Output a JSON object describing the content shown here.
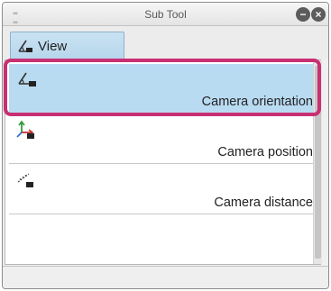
{
  "window": {
    "title": "Sub Tool",
    "grip_icon": "grip-icon",
    "minimize_icon": "minimize-icon",
    "close_icon": "close-icon",
    "minimize_glyph": "−",
    "close_glyph": "×"
  },
  "tabs": [
    {
      "label": "View",
      "icon": "view-angle-icon",
      "active": true
    }
  ],
  "tools": [
    {
      "label": "Camera orientation",
      "icon": "camera-orientation-icon",
      "selected": true
    },
    {
      "label": "Camera position",
      "icon": "camera-position-icon",
      "selected": false
    },
    {
      "label": "Camera distance",
      "icon": "camera-distance-icon",
      "selected": false
    }
  ],
  "colors": {
    "selection": "#b9dbf2",
    "highlight_border": "#c92f73",
    "tab_active": "#bcd9ee"
  }
}
